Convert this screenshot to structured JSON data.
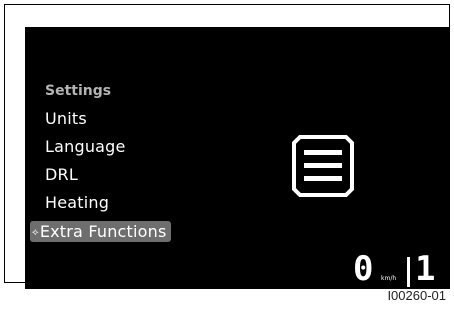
{
  "menu": {
    "title": "Settings",
    "items": [
      {
        "label": "Units"
      },
      {
        "label": "Language"
      },
      {
        "label": "DRL"
      },
      {
        "label": "Heating"
      },
      {
        "label": "Extra Functions"
      }
    ],
    "selected_arrow": "⟡"
  },
  "center_icon": "menu-list-icon",
  "status": {
    "speed": "0",
    "speed_unit": "km/h",
    "gear": "1"
  },
  "figure_code": "I00260-01",
  "colors": {
    "screen_bg": "#000000",
    "text": "#ffffff",
    "title": "#b3b3b3",
    "selection": "#6e6e6e"
  }
}
